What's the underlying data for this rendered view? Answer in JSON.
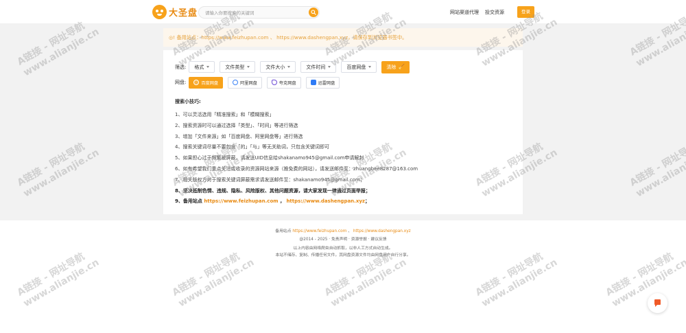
{
  "header": {
    "logo_text": "大圣盘",
    "search_placeholder": "请输入你要搜索的关键词",
    "nav": [
      "网站渠道代理",
      "投交资源"
    ],
    "login_label": "登录"
  },
  "notice": {
    "prefix": "◎! 备用站点：",
    "link1": "https://www.feizhupan.com",
    "sep": " 、 ",
    "link2": "https://www.dashengpan.xyz",
    "suffix": "，请保存到浏览器书签中。"
  },
  "filters": {
    "label": "筛选:",
    "selects": [
      "格式",
      "文件类型",
      "文件大小",
      "文件时间",
      "百度网盘"
    ],
    "clear_label": "清除"
  },
  "disks": {
    "label": "网盘:",
    "items": [
      {
        "label": "百度网盘",
        "color": "#ffffff"
      },
      {
        "label": "阿里网盘",
        "color": "#3b82f6"
      },
      {
        "label": "夸克网盘",
        "color": "#6d4cd6"
      },
      {
        "label": "迅雷网盘",
        "color": "#2f7bf5"
      }
    ]
  },
  "tips": {
    "title": "搜索小技巧:",
    "lines": [
      "1、可以灵活选用「精准搜索」和「模糊搜索」",
      "2、搜索资源时可以通过选择「类型」、「时间」等进行筛选",
      "3、增加「文件来源」如「百度网盘、阿里网盘等」进行筛选",
      "4、搜索关键词尽量不要包含「的」「与」等无关助词，只包含关键词即可",
      "5、如果担心过于频繁被屏蔽，请发送UID信息给shakanamo945@gmail.com申请解封",
      "6、如有希望我们重点关注或收录的资源网站来源（推免费的网站），请发送邮件至：zhuangbee8287@163.com",
      "7、相关版权方对于搜索关键词屏蔽需求请发送邮件至：shakanamo945@gmail.com；"
    ],
    "bold_line": "8、坚决抵制色情、违规、隐私、风险版权、其他问题资源，请大家发现一律通过页面举报；",
    "backup_prefix": "9、备用站点 ",
    "backup_link1": "https://www.feizhupan.com",
    "backup_sep": " ， ",
    "backup_link2": "https://www.dashengpan.xyz",
    "backup_suffix": "；"
  },
  "footer": {
    "backup_prefix": "备用站点 ",
    "link1": "https://www.feizhupan.com",
    "sep": " 、 ",
    "link2": "https://www.dashengpan.xyz",
    "copyright": "@2014 - 2025 · 免责声明 · 资源举报 · 建议反馈",
    "line3": "以上内容由网络爬虫自动抓取，以非人工方式自动生成。",
    "line4": "本站不储存、复制、传播任何文件，其网盘资源文件均由网盘用户自行分享。"
  },
  "watermark": {
    "line1": "A链接 - 网址导航",
    "line2": "www.alianjie.cn"
  }
}
